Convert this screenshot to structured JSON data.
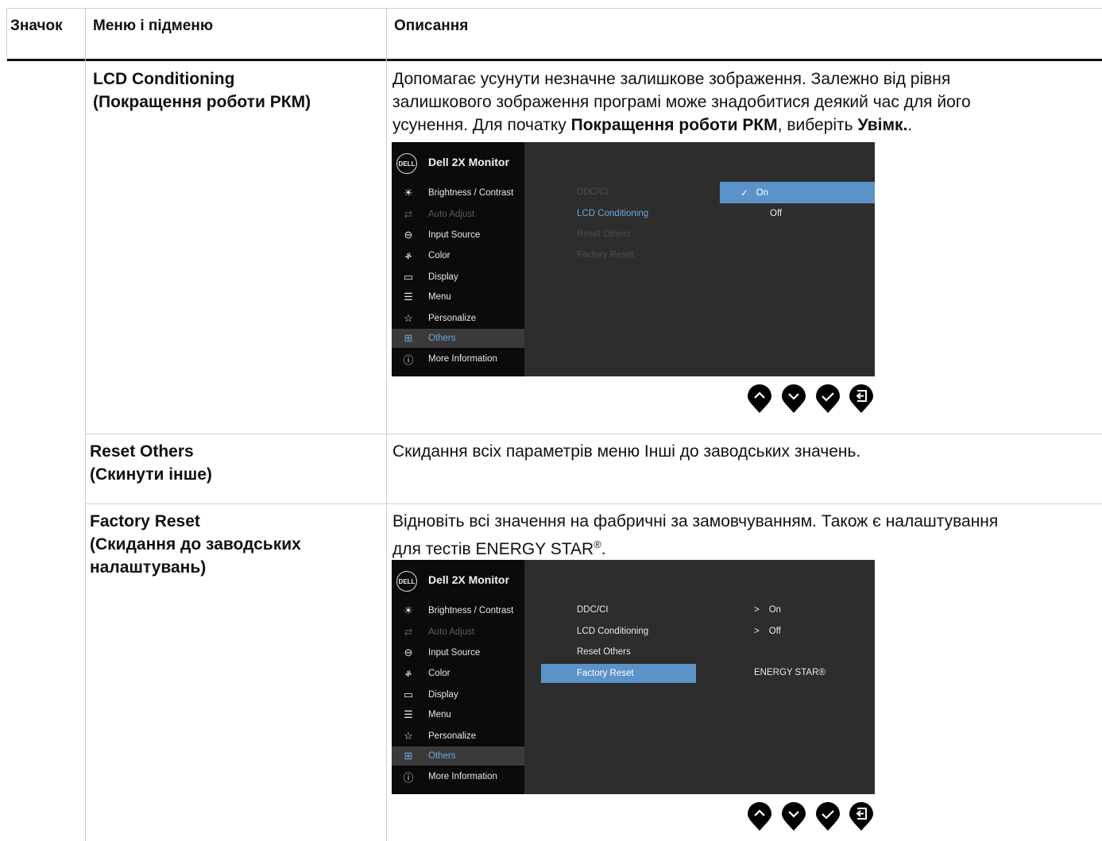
{
  "header": {
    "col_icon": "Значок",
    "col_menu": "Меню і підменю",
    "col_desc": "Описання"
  },
  "rows": [
    {
      "name_line1": "LCD Conditioning",
      "name_line2": "(Покращення роботи РКМ)",
      "desc_line1": "Допомагає усунути незначне залишкове зображення. Залежно від рівня",
      "desc_line2": "залишкового зображення програмі може знадобитися деякий час для його",
      "desc_line3_pre": "усунення. Для початку ",
      "desc_line3_b1": "Покращення роботи РКМ",
      "desc_line3_mid": ", виберіть ",
      "desc_line3_b2": "Увімк.",
      "desc_line3_end": "."
    },
    {
      "name_line1": "Reset Others",
      "name_line2": "(Скинути інше)",
      "desc": "Скидання всіх параметрів меню Інші до заводських значень."
    },
    {
      "name_line1": "Factory Reset",
      "name_line2": "(Скидання до заводських",
      "name_line3": "налаштувань)",
      "desc_line1": "Відновіть всі значення на фабричні за замовчуванням. Також є налаштування",
      "desc_line2_pre": "для тестів ENERGY STAR",
      "desc_line2_sup": "®",
      "desc_line2_end": "."
    }
  ],
  "osd": {
    "logo": "DELL",
    "title": "Dell 2X Monitor",
    "menu": [
      {
        "label": "Brightness / Contrast",
        "icon": "brightness-icon"
      },
      {
        "label": "Auto Adjust",
        "icon": "auto-adjust-icon"
      },
      {
        "label": "Input Source",
        "icon": "input-source-icon"
      },
      {
        "label": "Color",
        "icon": "color-icon"
      },
      {
        "label": "Display",
        "icon": "display-icon"
      },
      {
        "label": "Menu",
        "icon": "menu-icon"
      },
      {
        "label": "Personalize",
        "icon": "star-icon"
      },
      {
        "label": "Others",
        "icon": "others-icon"
      },
      {
        "label": "More Information",
        "icon": "info-icon"
      }
    ],
    "sub": [
      "DDC/CI",
      "LCD Conditioning",
      "Reset Others",
      "Factory Reset"
    ],
    "osd1_options": [
      "On",
      "Off"
    ],
    "osd2_values": [
      "On",
      "Off"
    ],
    "osd2_energy": "ENERGY STAR®",
    "check_mark": "✓",
    "arrow_mark": ">"
  },
  "colors": {
    "osd_bg": "#2d2d2d",
    "osd_left": "#0b0b0b",
    "highlight": "#5b93c9",
    "selected_text": "#6fa8dc"
  }
}
